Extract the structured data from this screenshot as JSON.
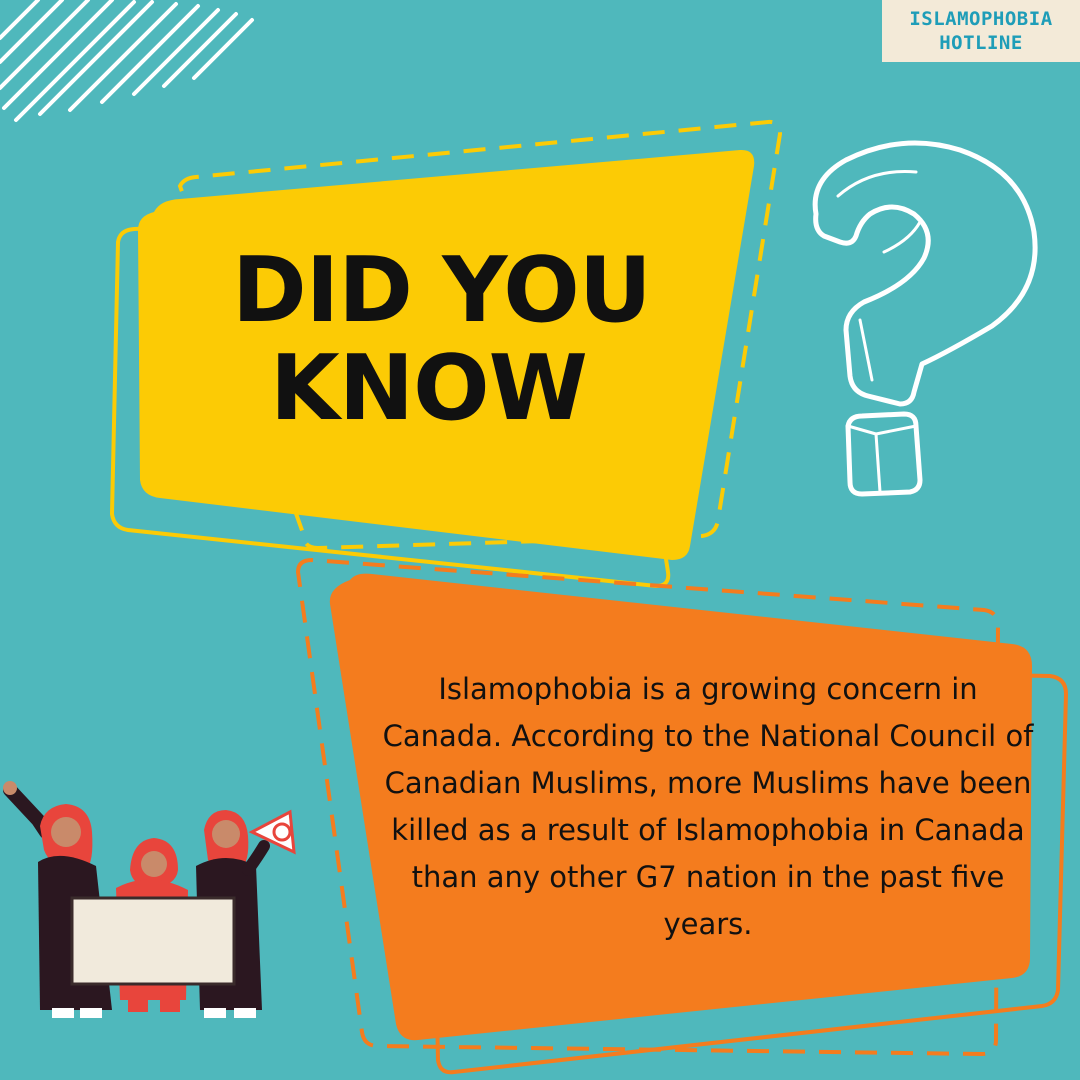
{
  "logo": {
    "line1": "ISLAMOPHOBIA",
    "line2": "HOTLINE"
  },
  "headline": {
    "line1": "DID YOU",
    "line2": "KNOW"
  },
  "fact": "Islamophobia is a growing concern in Canada. According to the National Council of Canadian Muslims, more Muslims have been killed as a result of Islamophobia in Canada than any other G7 nation in the past five years.",
  "colors": {
    "background": "#4fb8bc",
    "yellow": "#fccb05",
    "orange": "#f47c1e",
    "white": "#ffffff",
    "text": "#111111",
    "logo_text": "#1e9db8"
  }
}
